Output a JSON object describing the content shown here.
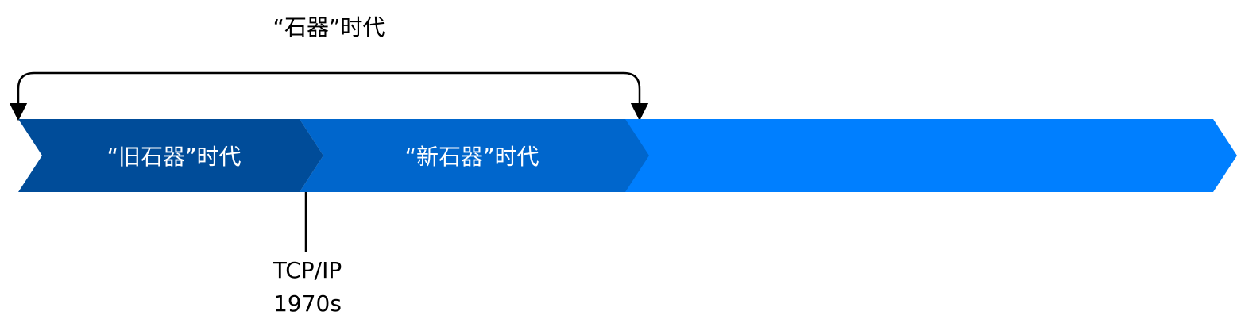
{
  "top_span": {
    "label": "“石器”时代"
  },
  "segments": [
    {
      "label": "“旧石器”时代",
      "color": "#004c99"
    },
    {
      "label": "“新石器”时代",
      "color": "#0066cc"
    },
    {
      "label": "",
      "color": "#007fff"
    }
  ],
  "milestone": {
    "line1": "TCP/IP",
    "line2": "1970s"
  },
  "colors": {
    "line": "#000000",
    "text_on_arrow": "#ffffff",
    "text": "#000000"
  }
}
